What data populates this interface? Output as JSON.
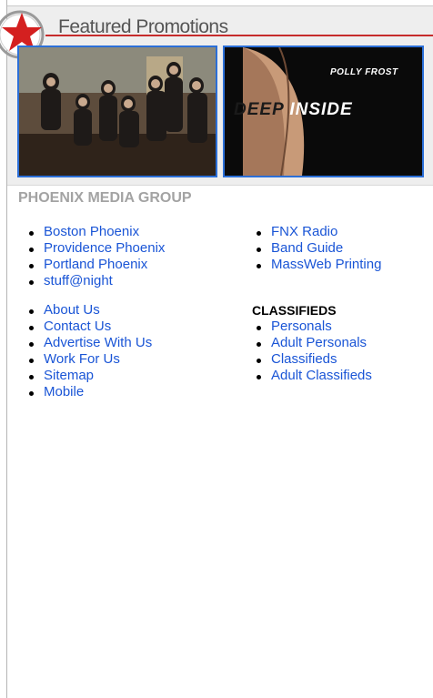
{
  "header": {
    "title": "Featured Promotions"
  },
  "promos": [
    {
      "alt": "Band photo"
    },
    {
      "author": "POLLY FROST",
      "title_word1": "DEEP",
      "title_word2": "INSIDE"
    }
  ],
  "section": {
    "title": "PHOENIX MEDIA GROUP"
  },
  "left_group1": [
    "Boston Phoenix",
    "Providence Phoenix",
    "Portland Phoenix",
    "stuff@night"
  ],
  "left_group2": [
    "About Us",
    "Contact Us",
    "Advertise With Us",
    "Work For Us",
    "Sitemap",
    "Mobile"
  ],
  "right_group1": [
    "FNX Radio",
    "Band Guide",
    "MassWeb Printing"
  ],
  "classifieds": {
    "heading": "CLASSIFIEDS",
    "items": [
      "Personals",
      "Adult Personals",
      "Classifieds",
      "Adult Classifieds"
    ]
  },
  "colors": {
    "link": "#1a55d6",
    "accent_red": "#c62b2b",
    "section_gray": "#a3a3a3"
  }
}
